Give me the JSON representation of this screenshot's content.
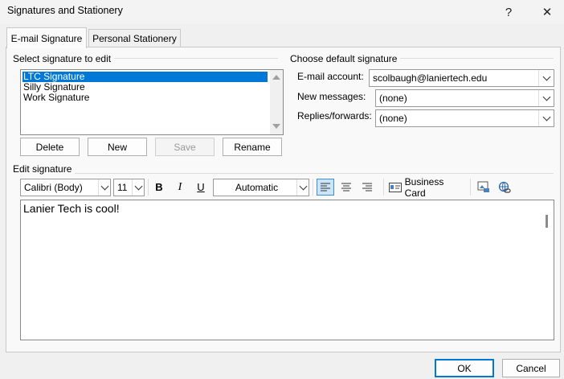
{
  "window": {
    "title": "Signatures and Stationery",
    "help": "?",
    "close": "✕"
  },
  "tabs": [
    {
      "label": "E-mail Signature",
      "active": true
    },
    {
      "label": "Personal Stationery",
      "active": false
    }
  ],
  "select_section": {
    "label": "Select signature to edit",
    "signatures": [
      "LTC Signature",
      "Silly Signature",
      "Work Signature"
    ],
    "selected_index": 0,
    "buttons": {
      "delete": "Delete",
      "new": "New",
      "save": "Save",
      "rename": "Rename"
    }
  },
  "default_section": {
    "label": "Choose default signature",
    "email_account_label": "E-mail account:",
    "email_account_value": "scolbaugh@laniertech.edu",
    "new_messages_label": "New messages:",
    "new_messages_value": "(none)",
    "replies_label": "Replies/forwards:",
    "replies_value": "(none)"
  },
  "edit_section": {
    "label": "Edit signature",
    "font": "Calibri (Body)",
    "size": "11",
    "bold": "B",
    "italic": "I",
    "underline": "U",
    "color": "Automatic",
    "business_card": "Business Card",
    "content": "Lanier Tech is cool!"
  },
  "footer": {
    "ok": "OK",
    "cancel": "Cancel"
  },
  "colors": {
    "accent": "#0078d7",
    "selection": "#0078d7"
  }
}
